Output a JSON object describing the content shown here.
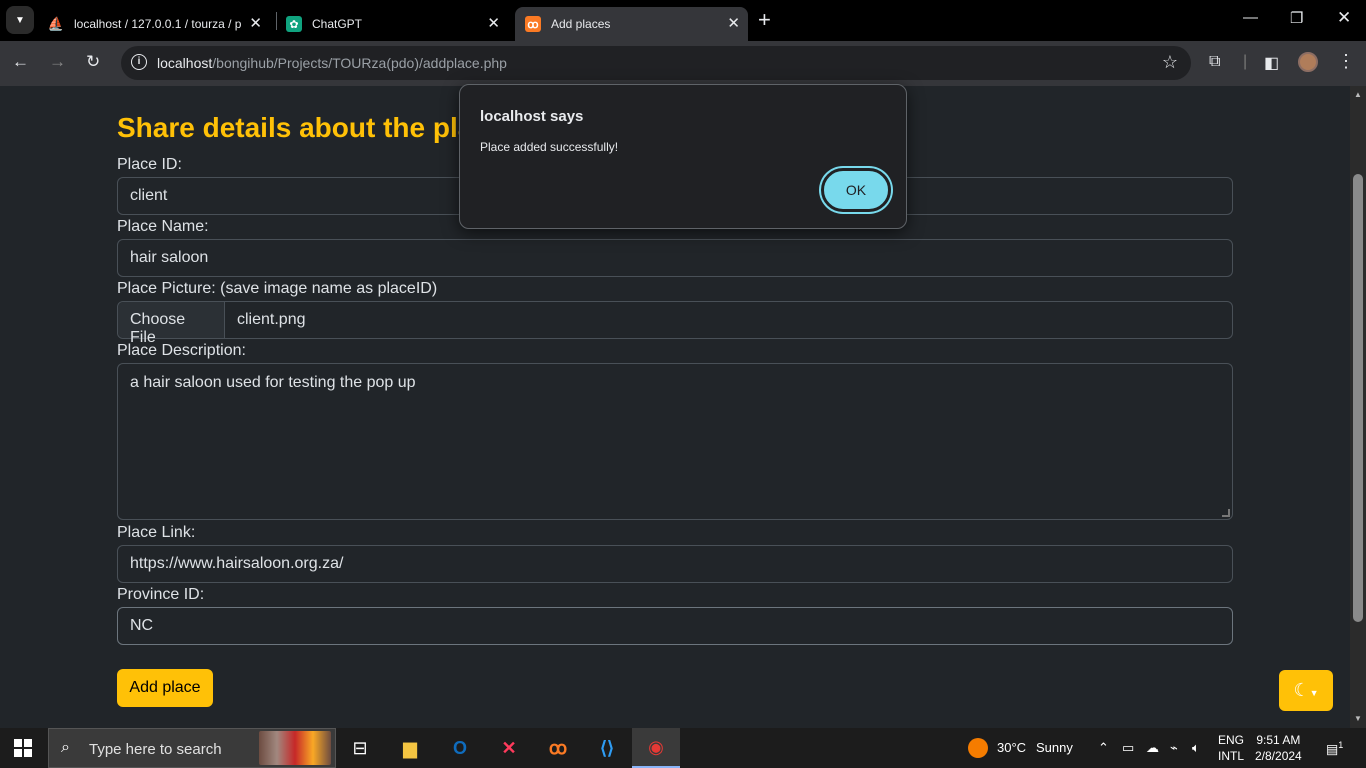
{
  "browser": {
    "tabs": [
      {
        "title": "localhost / 127.0.0.1 / tourza / p",
        "icon": "phpmyadmin-icon",
        "active": false
      },
      {
        "title": "ChatGPT",
        "icon": "chatgpt-icon",
        "active": false
      },
      {
        "title": "Add places",
        "icon": "xampp-icon",
        "active": true
      }
    ],
    "url_host": "localhost",
    "url_path": "/bongihub/Projects/TOURza(pdo)/addplace.php"
  },
  "page": {
    "heading": "Share details about the place",
    "place_id_label": "Place ID:",
    "place_id_value": "client",
    "place_name_label": "Place Name:",
    "place_name_value": "hair saloon",
    "place_picture_label": "Place Picture: (save image name as placeID)",
    "choose_file_label": "Choose File",
    "file_name": "client.png",
    "description_label": "Place Description:",
    "description_value": "a hair saloon used for testing the pop up",
    "link_label": "Place Link:",
    "link_value": "https://www.hairsaloon.org.za/",
    "province_label": "Province ID:",
    "province_value": "NC",
    "submit_label": "Add place",
    "accent_color": "#ffc107"
  },
  "dialog": {
    "title": "localhost says",
    "message": "Place added successfully!",
    "ok_label": "OK"
  },
  "taskbar": {
    "search_placeholder": "Type here to search",
    "weather_temp": "30°C",
    "weather_desc": "Sunny",
    "lang_line1": "ENG",
    "lang_line2": "INTL",
    "time": "9:51 AM",
    "date": "2/8/2024",
    "notification_count": "1"
  }
}
